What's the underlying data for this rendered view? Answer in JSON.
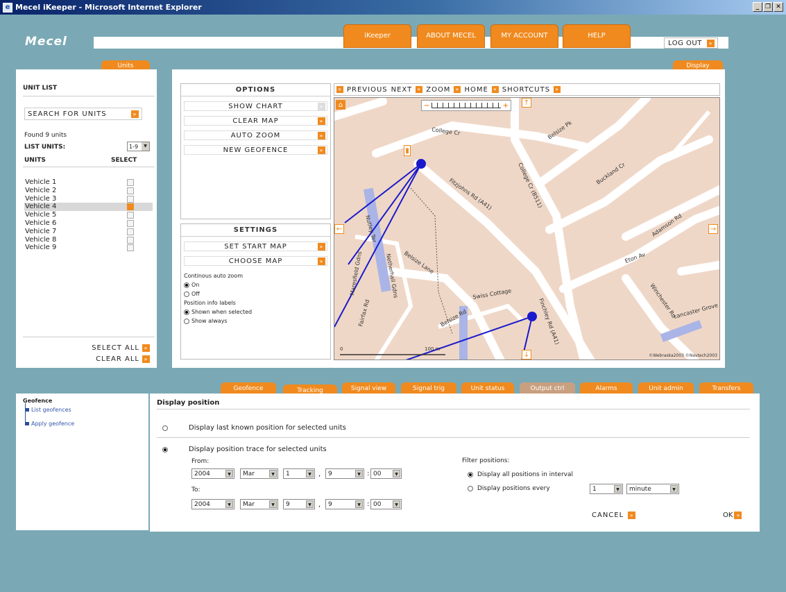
{
  "window": {
    "title": "Mecel iKeeper - Microsoft Internet Explorer"
  },
  "brand": {
    "logo": "Mecel"
  },
  "top_nav": {
    "items": [
      "iKeeper",
      "ABOUT MECEL",
      "MY ACCOUNT",
      "HELP"
    ],
    "logout": "LOG OUT"
  },
  "units_panel": {
    "tab": "Units",
    "heading": "UNIT LIST",
    "search_label": "SEARCH FOR UNITS",
    "found": "Found 9 units",
    "list_units_label": "LIST UNITS:",
    "list_units_value": "1-9",
    "col_units": "UNITS",
    "col_select": "SELECT",
    "vehicles": [
      "Vehicle 1",
      "Vehicle 2",
      "Vehicle 3",
      "Vehicle 4",
      "Vehicle 5",
      "Vehicle 6",
      "Vehicle 7",
      "Vehicle 8",
      "Vehicle 9"
    ],
    "selected_vehicle": "Vehicle 4",
    "select_all": "SELECT ALL",
    "clear_all": "CLEAR ALL"
  },
  "display_panel": {
    "tab": "Display",
    "options": {
      "heading": "OPTIONS",
      "buttons": [
        "SHOW CHART",
        "CLEAR MAP",
        "AUTO ZOOM",
        "NEW GEOFENCE"
      ]
    },
    "settings": {
      "heading": "SETTINGS",
      "buttons": [
        "SET START MAP",
        "CHOOSE MAP"
      ],
      "auto_zoom_label": "Continous auto zoom",
      "auto_zoom_on": "On",
      "auto_zoom_off": "Off",
      "labels_label": "Position info labels",
      "labels_selected": "Shown when selected",
      "labels_always": "Show always"
    },
    "map_toolbar": [
      "PREVIOUS",
      "NEXT",
      "ZOOM",
      "HOME",
      "SHORTCUTS"
    ],
    "map": {
      "streets": [
        "College Cr",
        "Fitzjohns Rd (A41)",
        "Belsize Pk",
        "Buckland Cr",
        "College Cr (B511)",
        "Adamson Rd",
        "Eton Av",
        "Maresfield Gdns",
        "Nutley Ter",
        "Netherhall Gdns",
        "Belsize Lane",
        "Fairfax Rd",
        "Belsize Rd",
        "Swiss Cottage",
        "Finchley Rd (A41)",
        "Winchester Rd",
        "Lancaster Grove"
      ],
      "scale_labels": [
        "0",
        "100 m"
      ],
      "copyright": "©Webraska2003 ©Navtech2003"
    }
  },
  "bottom_tabs": [
    "Geofence",
    "Tracking",
    "Signal view",
    "Signal trig",
    "Unit status",
    "Output ctrl",
    "Alarms",
    "Unit admin",
    "Transfers"
  ],
  "active_bottom_tab": "Tracking",
  "geofence_panel": {
    "title": "Geofence",
    "items": [
      "List geofences",
      "Apply geofence"
    ]
  },
  "tracking": {
    "title": "Display position",
    "option_last": "Display last known position for selected units",
    "option_trace": "Display position trace for selected units",
    "from_label": "From:",
    "from": {
      "year": "2004",
      "month": "Mar",
      "day": "1",
      "hour": "9",
      "minute": "00"
    },
    "to_label": "To:",
    "to": {
      "year": "2004",
      "month": "Mar",
      "day": "9",
      "hour": "9",
      "minute": "00"
    },
    "filter_label": "Filter positions:",
    "filter_all": "Display all positions in interval",
    "filter_every": "Display positions every",
    "every_value": "1",
    "every_unit": "minute",
    "cancel": "CANCEL",
    "ok": "OK",
    "date_sep": ",",
    "time_sep": ":"
  },
  "colors": {
    "accent": "#f08a1e",
    "background": "#7aa9b5",
    "map_bg": "#efd7c7",
    "route": "#1a1acc"
  }
}
